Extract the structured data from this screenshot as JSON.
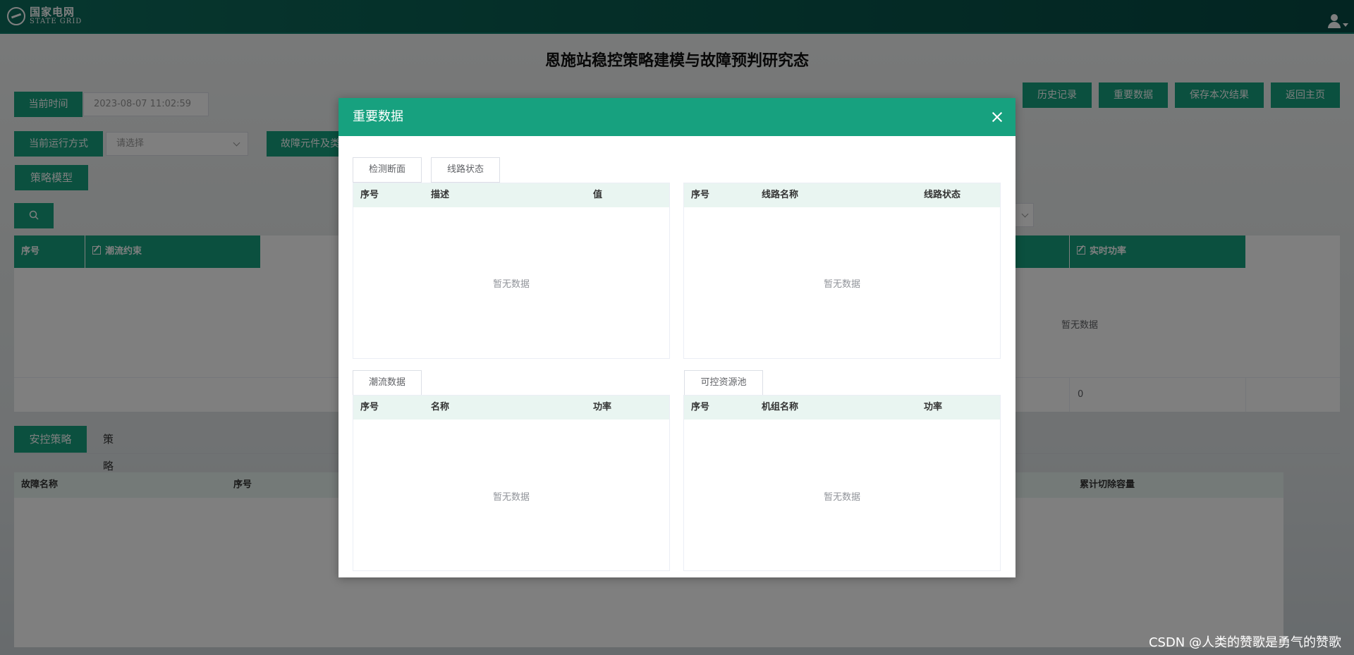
{
  "header": {
    "logo_cn": "国家电网",
    "logo_en": "STATE GRID"
  },
  "page_title": "恩施站稳控策略建模与故障预判研究态",
  "toolbar": {
    "current_time_label": "当前时间",
    "current_time_value": "2023-08-07  11:02:59",
    "run_mode_label": "当前运行方式",
    "run_mode_placeholder": "请选择",
    "fault_component_label": "故障元件及类",
    "strategy_model_label": "策略模型",
    "history_button": "历史记录",
    "important_data_button": "重要数据",
    "save_result_button": "保存本次结果",
    "return_home_button": "返回主页"
  },
  "bg_table": {
    "col_index": "序号",
    "col_flow_constraint": "潮流约束",
    "col_realtime_power": "实时功率",
    "empty_text": "暂无数据",
    "row_value": "0"
  },
  "lower_tabs": {
    "active": "安控策略",
    "other": "策略校核"
  },
  "lower_table": {
    "col_fault_name": "故障名称",
    "col_index": "序号",
    "col_cumulative_cut": "累计切除容量"
  },
  "modal": {
    "title": "重要数据",
    "empty_text": "暂无数据",
    "panels": {
      "detect_section": {
        "tab": "检测断面",
        "headers": [
          "序号",
          "描述",
          "值"
        ]
      },
      "line_status": {
        "tab": "线路状态",
        "headers": [
          "序号",
          "线路名称",
          "线路状态"
        ]
      },
      "flow_data": {
        "tab": "潮流数据",
        "headers": [
          "序号",
          "名称",
          "功率"
        ]
      },
      "controllable_pool": {
        "tab": "可控资源池",
        "headers": [
          "序号",
          "机组名称",
          "功率"
        ]
      }
    }
  },
  "watermark": "CSDN @人类的赞歌是勇气的赞歌",
  "colors": {
    "primary_green": "#17a17f",
    "header_dark": "#0a5c50",
    "table_head_light": "#e9f5f1"
  }
}
